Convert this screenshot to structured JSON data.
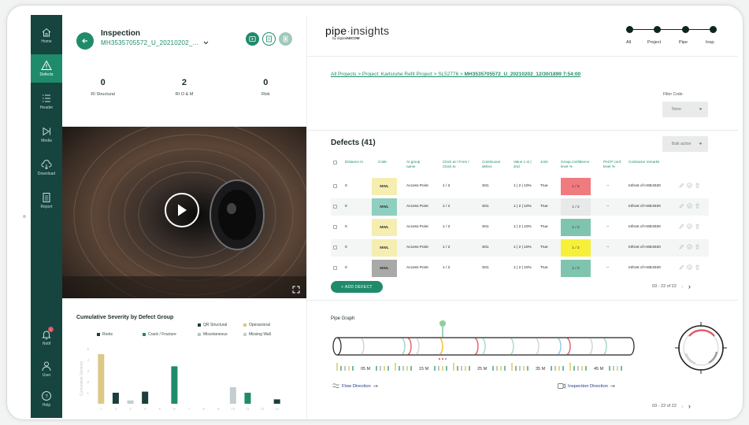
{
  "sidebar": {
    "items": [
      {
        "label": "Home",
        "icon": "home-icon",
        "active": false
      },
      {
        "label": "Defects",
        "icon": "warning-icon",
        "active": true
      },
      {
        "label": "Header",
        "icon": "list-icon",
        "active": false
      },
      {
        "label": "Media",
        "icon": "media-icon",
        "active": false
      },
      {
        "label": "Download",
        "icon": "cloud-download-icon",
        "active": false
      },
      {
        "label": "Report",
        "icon": "report-icon",
        "active": false
      }
    ],
    "bottom": [
      {
        "label": "Notif",
        "icon": "bell-icon",
        "badge": "1"
      },
      {
        "label": "User",
        "icon": "user-icon"
      },
      {
        "label": "Help",
        "icon": "help-icon"
      }
    ]
  },
  "inspection": {
    "title": "Inspection",
    "id": "MH3535705572_U_20210202_...",
    "stats": [
      {
        "value": "0",
        "label": "RI Structural"
      },
      {
        "value": "2",
        "label": "RI O & M"
      },
      {
        "value": "0",
        "label": "Risk"
      }
    ]
  },
  "severity_chart": {
    "title": "Cumulative Severity by Defect Group",
    "legend": [
      {
        "name": "QR Structural",
        "color": "#1a3f3c"
      },
      {
        "name": "Operacional",
        "color": "#d6c98a"
      },
      {
        "name": "Roots",
        "color": "#1a3f3c"
      },
      {
        "name": "Crack / Fracture",
        "color": "#1f8b6b"
      },
      {
        "name": "Miscelaneous",
        "color": "#b9c4c9"
      },
      {
        "name": "Missing Wall",
        "color": "#c4cdd0"
      }
    ],
    "ylabel": "Cumulative Severity",
    "yticks": [
      "5",
      "4",
      "3",
      "2",
      "1"
    ],
    "xticks": [
      "1",
      "2",
      "3",
      "4",
      "5",
      "6",
      "7",
      "8",
      "9",
      "10",
      "11",
      "12",
      "13"
    ]
  },
  "chart_data": {
    "type": "bar",
    "title": "Cumulative Severity by Defect Group",
    "ylabel": "Cumulative Severity",
    "xlabel": "",
    "ylim": [
      0,
      5
    ],
    "categories": [
      "1",
      "2",
      "3",
      "4",
      "5",
      "6",
      "7",
      "8",
      "9",
      "10",
      "11",
      "12",
      "13"
    ],
    "values": [
      4.5,
      1.0,
      0.3,
      1.1,
      0,
      3.4,
      0,
      0,
      0,
      1.5,
      1.0,
      0,
      0.4
    ],
    "colors": [
      "#dcc987",
      "#1a3f3c",
      "#c4cdd0",
      "#1a3f3c",
      "",
      "#1f8b6b",
      "",
      "",
      "",
      "#c4cdd0",
      "#1f8b6b",
      "",
      "#1a3f3c"
    ]
  },
  "brand": {
    "name_a": "pipe",
    "name_b": "insights",
    "sub_a": "by digital",
    "sub_b": "AECOM"
  },
  "steps": [
    {
      "label": "All"
    },
    {
      "label": "Project"
    },
    {
      "label": "Pipe"
    },
    {
      "label": "Insp."
    }
  ],
  "breadcrumb": {
    "plain": "All Projects  > Project: Karlsruhe Refit Project > SL52776 > ",
    "bold": "MH3535705572_U_20210202_12/30/1899 7:54:00"
  },
  "filter": {
    "label": "Filter Code:",
    "value": "None"
  },
  "bulk_action": "Bulk action",
  "defects": {
    "title": "Defects (41)",
    "columns": [
      "Distance m",
      "Code",
      "AI group name",
      "Clock at / From / Clock to",
      "Continuous defect",
      "Value 1 st | 2nd",
      "Joint",
      "Group confidence level %",
      "PACP conf. level %",
      "Contractor remarks"
    ],
    "rows": [
      {
        "distance": "0",
        "code": "MWL",
        "group": "Access Point",
        "clock": "1 / 2",
        "continuous": "S01",
        "value": "1 | 2 | 10%",
        "joint": "True",
        "conf": "1 / 2",
        "pacp": "--",
        "remarks": "Infront of HSE4020",
        "code_color": "#f5eeb0",
        "conf_color": "#ef7b7f"
      },
      {
        "distance": "0",
        "code": "MWL",
        "group": "Access Point",
        "clock": "1 / 2",
        "continuous": "S01",
        "value": "1 | 2 | 10%",
        "joint": "True",
        "conf": "1 / 2",
        "pacp": "--",
        "remarks": "Infront of HSE4020",
        "code_color": "#8fcfbf",
        "conf_color": "#e8eaea"
      },
      {
        "distance": "0",
        "code": "MWL",
        "group": "Access Point",
        "clock": "1 / 2",
        "continuous": "S01",
        "value": "1 | 2 | 10%",
        "joint": "True",
        "conf": "1 / 2",
        "pacp": "--",
        "remarks": "Infront of HSE4020",
        "code_color": "#f5eeb0",
        "conf_color": "#7fc4ae"
      },
      {
        "distance": "0",
        "code": "MWL",
        "group": "Access Point",
        "clock": "1 / 2",
        "continuous": "S01",
        "value": "1 | 2 | 10%",
        "joint": "True",
        "conf": "1 / 2",
        "pacp": "--",
        "remarks": "Infront of HSE4020",
        "code_color": "#f5eeb0",
        "conf_color": "#f6f03a"
      },
      {
        "distance": "0",
        "code": "MWL",
        "group": "Access Point",
        "clock": "1 / 2",
        "continuous": "S01",
        "value": "1 | 2 | 10%",
        "joint": "True",
        "conf": "1 / 2",
        "pacp": "--",
        "remarks": "Infront of HSE4020",
        "code_color": "#a9aaa8",
        "conf_color": "#7fc4ae"
      }
    ],
    "add_label": "+   ADD DEFECT",
    "pager": "03 - 22 of 22"
  },
  "pipe_graph": {
    "title": "Pipe Graph",
    "marks": [
      "05 M",
      "15 M",
      "25 M",
      "35 M",
      "45 M"
    ],
    "flow_direction": "Flow Direction",
    "inspection_direction": "Inspection Direction",
    "pager": "03 - 22 of 22"
  }
}
